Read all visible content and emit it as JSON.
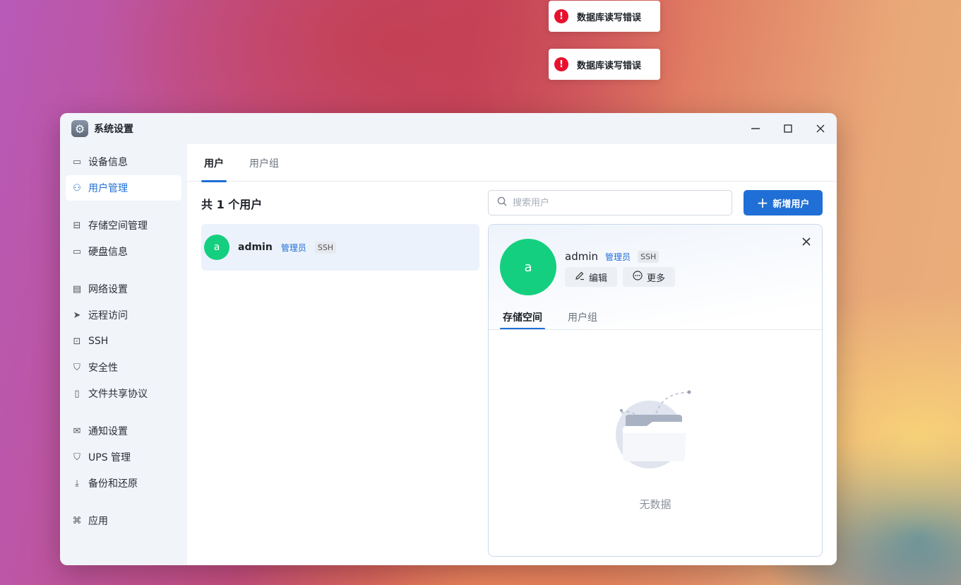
{
  "toasts": [
    {
      "icon": "error-icon",
      "text": "数据库读写错误"
    },
    {
      "icon": "error-icon",
      "text": "数据库读写错误"
    }
  ],
  "window": {
    "title": "系统设置",
    "icon": "gear-icon",
    "controls": {
      "minimize": "—",
      "maximize": "☐",
      "close": "✕"
    }
  },
  "sidebar": {
    "items": [
      {
        "label": "设备信息",
        "icon": "drive-icon"
      },
      {
        "label": "用户管理",
        "icon": "user-icon",
        "active": true
      },
      {
        "label": "存储空间管理",
        "icon": "storage-icon"
      },
      {
        "label": "硬盘信息",
        "icon": "disk-icon"
      },
      {
        "label": "网络设置",
        "icon": "network-icon"
      },
      {
        "label": "远程访问",
        "icon": "send-icon"
      },
      {
        "label": "SSH",
        "icon": "terminal-icon"
      },
      {
        "label": "安全性",
        "icon": "shield-check-icon"
      },
      {
        "label": "文件共享协议",
        "icon": "file-icon"
      },
      {
        "label": "通知设置",
        "icon": "mail-icon"
      },
      {
        "label": "UPS 管理",
        "icon": "shield-icon"
      },
      {
        "label": "备份和还原",
        "icon": "backup-icon"
      },
      {
        "label": "应用",
        "icon": "apps-icon"
      }
    ]
  },
  "tabs": [
    {
      "label": "用户",
      "active": true
    },
    {
      "label": "用户组",
      "active": false
    }
  ],
  "user_count_text": "共 1 个用户",
  "search": {
    "placeholder": "搜索用户",
    "value": ""
  },
  "add_button": {
    "label": "新增用户"
  },
  "users": [
    {
      "avatar_letter": "a",
      "name": "admin",
      "role": "管理员",
      "badge": "SSH"
    }
  ],
  "detail": {
    "avatar_letter": "a",
    "name": "admin",
    "role": "管理员",
    "badge": "SSH",
    "edit_label": "编辑",
    "more_label": "更多",
    "tabs": [
      {
        "label": "存储空间",
        "active": true
      },
      {
        "label": "用户组",
        "active": false
      }
    ],
    "empty_text": "无数据"
  },
  "colors": {
    "accent": "#1f6fd6",
    "avatar": "#14cf7f",
    "error": "#e8112d"
  }
}
